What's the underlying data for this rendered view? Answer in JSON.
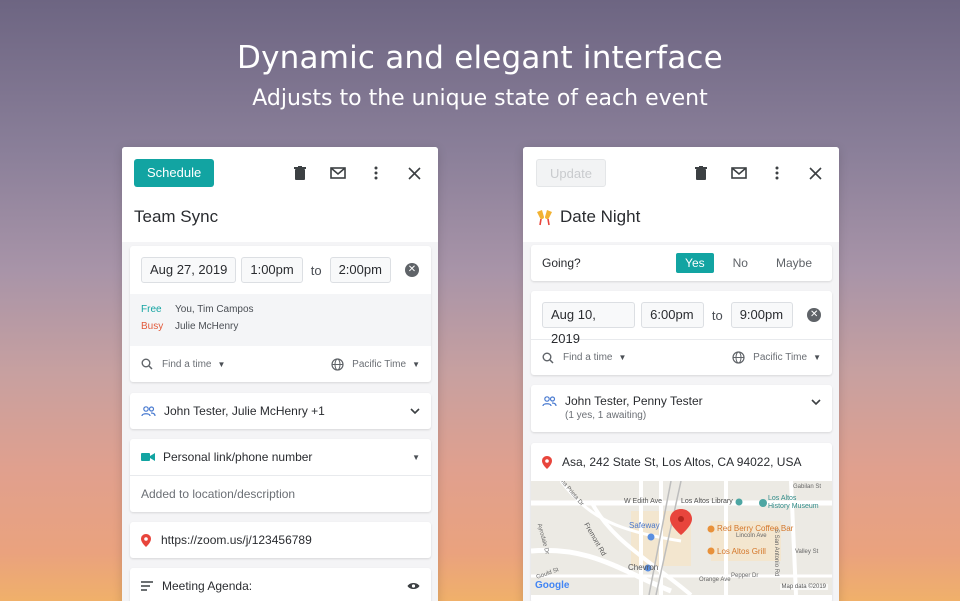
{
  "headline": {
    "title": "Dynamic and elegant interface",
    "subtitle": "Adjusts to the unique state of each event"
  },
  "left": {
    "primary_button": "Schedule",
    "title": "Team Sync",
    "date": "Aug 27, 2019",
    "start": "1:00pm",
    "to": "to",
    "end": "2:00pm",
    "availability": [
      {
        "status": "Free",
        "people": "You, Tim Campos"
      },
      {
        "status": "Busy",
        "people": "Julie McHenry"
      }
    ],
    "find_time": "Find a time",
    "timezone": "Pacific Time",
    "attendees": "John Tester, Julie McHenry +1",
    "conference": "Personal link/phone number",
    "conference_note": "Added to location/description",
    "location": "https://zoom.us/j/123456789",
    "description": "Meeting Agenda:"
  },
  "right": {
    "primary_button": "Update",
    "title": "Date Night",
    "going_label": "Going?",
    "rsvp": [
      "Yes",
      "No",
      "Maybe"
    ],
    "rsvp_selected": "Yes",
    "date": "Aug 10, 2019",
    "start": "6:00pm",
    "to": "to",
    "end": "9:00pm",
    "find_time": "Find a time",
    "timezone": "Pacific Time",
    "attendees": "John Tester, Penny Tester",
    "attendees_status": "(1 yes, 1 awaiting)",
    "location": "Asa, 242 State St, Los Altos, CA 94022, USA",
    "map": {
      "labels": {
        "edith": "W Edith Ave",
        "library": "Los Altos Library",
        "museum": "Los Altos",
        "museum2": "History Museum",
        "safeway": "Safeway",
        "redberry": "Red Berry Coffee Bar",
        "grill": "Los Altos Grill",
        "chevron": "Chevron",
        "fremont": "Fremont Rd",
        "lincoln": "Lincoln Ave",
        "valley": "Valley St",
        "pepper": "Pepper Dr",
        "gabilan": "Gabilan St",
        "loma": "Loma Prieta Dr",
        "ayrodale": "Ayrodale Dr",
        "gould": "Gould St",
        "orange": "Orange Ave",
        "sanantonio": "S San Antonio Rd"
      },
      "google": "Google",
      "attribution": "Map data ©2019"
    }
  },
  "colors": {
    "accent": "#12a4a2",
    "busy": "#e25a3b",
    "pin": "#e8453c"
  }
}
